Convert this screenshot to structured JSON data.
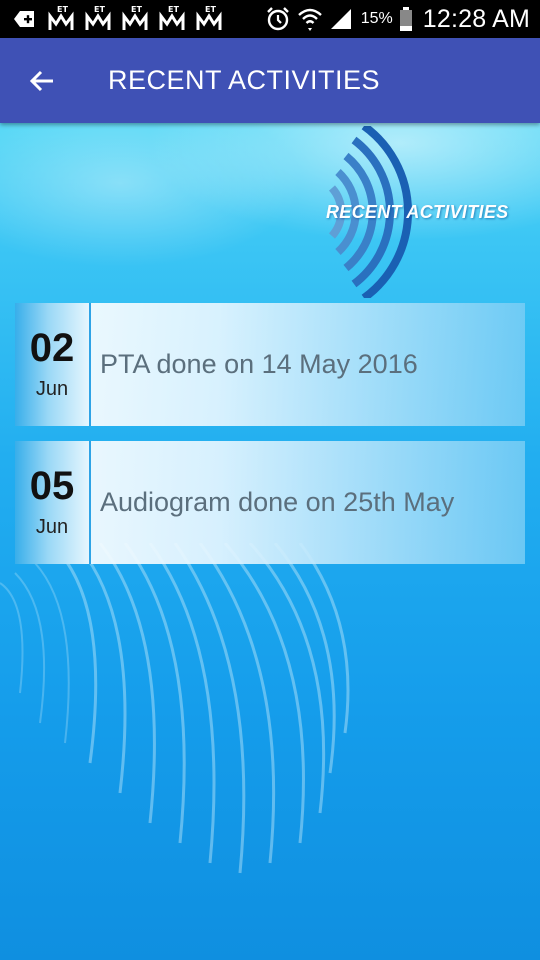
{
  "status_bar": {
    "et_label": "ET",
    "battery_percent": "15%",
    "time": "12:28 AM"
  },
  "app_bar": {
    "title": "RECENT ACTIVITIES"
  },
  "banner": {
    "text": "RECENT ACTIVITIES"
  },
  "activities": [
    {
      "day": "02",
      "month": "Jun",
      "text": "PTA done on 14 May 2016"
    },
    {
      "day": "05",
      "month": "Jun",
      "text": "Audiogram done on 25th May"
    }
  ],
  "colors": {
    "app_bar": "#3f51b5",
    "status_bar": "#000000",
    "background": "#1aa3ef"
  }
}
